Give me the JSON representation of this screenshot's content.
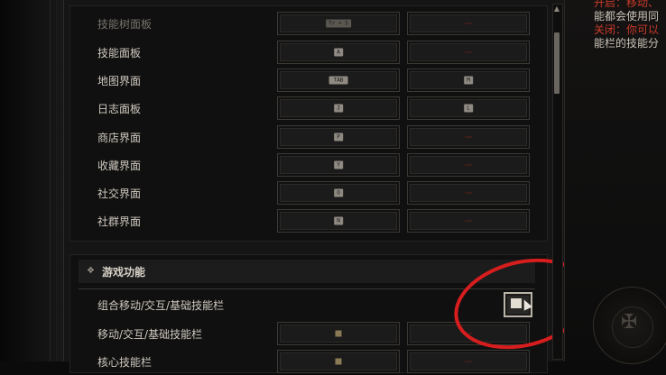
{
  "keybindings": [
    {
      "label": "技能树面板",
      "key1": "Tr + S",
      "key2": "",
      "dim": true
    },
    {
      "label": "技能面板",
      "key1": "A",
      "key2": ""
    },
    {
      "label": "地图界面",
      "key1": "TAB",
      "key2": "M"
    },
    {
      "label": "日志面板",
      "key1": "J",
      "key2": "L"
    },
    {
      "label": "商店界面",
      "key1": "P",
      "key2": ""
    },
    {
      "label": "收藏界面",
      "key1": "Y",
      "key2": ""
    },
    {
      "label": "社交界面",
      "key1": "O",
      "key2": ""
    },
    {
      "label": "社群界面",
      "key1": "N",
      "key2": ""
    }
  ],
  "game_section": {
    "title": "游戏功能",
    "combined_toggle_label": "组合移动/交互/基础技能栏",
    "row2_label": "移动/交互/基础技能栏",
    "row3_label": "核心技能栏"
  },
  "right_panel": {
    "line1_red": "开启：移动、",
    "line2": "能都会使用同",
    "line3_red": "关闭：你可以",
    "line4": "能栏的技能分"
  },
  "icons": {
    "scroll_up": "▲",
    "diamond": "❖",
    "emblem": "✠"
  }
}
